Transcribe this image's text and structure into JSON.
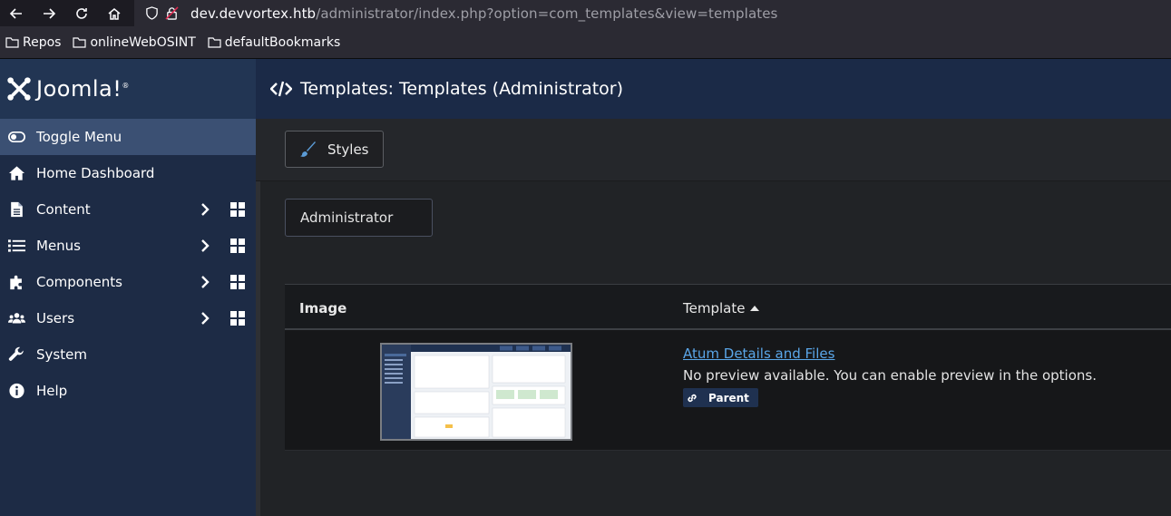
{
  "browser": {
    "url_domain": "dev.devvortex.htb",
    "url_path": "/administrator/index.php?option=com_templates&view=templates",
    "bookmarks": [
      "Repos",
      "onlineWebOSINT",
      "defaultBookmarks"
    ]
  },
  "brand": {
    "logo_text": "Joomla!",
    "logo_mark": "®"
  },
  "sidebar": {
    "items": [
      {
        "label": "Toggle Menu",
        "icon": "toggle-icon",
        "active": true
      },
      {
        "label": "Home Dashboard",
        "icon": "home-icon"
      },
      {
        "label": "Content",
        "icon": "file-icon",
        "expandable": true
      },
      {
        "label": "Menus",
        "icon": "list-icon",
        "expandable": true
      },
      {
        "label": "Components",
        "icon": "puzzle-icon",
        "expandable": true
      },
      {
        "label": "Users",
        "icon": "users-icon",
        "expandable": true
      },
      {
        "label": "System",
        "icon": "wrench-icon"
      },
      {
        "label": "Help",
        "icon": "info-icon"
      }
    ]
  },
  "header": {
    "title": "Templates: Templates (Administrator)"
  },
  "toolbar": {
    "styles_label": "Styles"
  },
  "filter": {
    "client_value": "Administrator"
  },
  "table": {
    "columns": {
      "image": "Image",
      "template": "Template"
    },
    "rows": [
      {
        "link": "Atum Details and Files",
        "description": "No preview available. You can enable preview in the options.",
        "badge": "Parent"
      }
    ]
  },
  "colors": {
    "sidebar_bg": "#1d2b45",
    "header_bg": "#1b2a47",
    "link": "#5aa6e8",
    "badge_bg": "#1f3150"
  }
}
